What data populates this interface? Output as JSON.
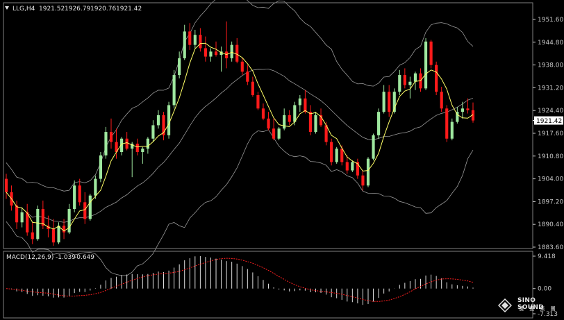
{
  "header": {
    "symbol": "LLG,H4",
    "open": "1921.52",
    "high": "1926.79",
    "low": "1920.76",
    "close": "1921.42"
  },
  "macd_header": {
    "label": "MACD(12,26,9)",
    "macd_value": "-1.039",
    "signal_value": "-0.649"
  },
  "price_axis": {
    "ticks": [
      "1951.60",
      "1944.80",
      "1938.00",
      "1931.20",
      "1924.40",
      "1917.60",
      "1910.80",
      "1904.00",
      "1897.20",
      "1890.40",
      "1883.60"
    ],
    "current_price": "1921.42"
  },
  "macd_axis": {
    "ticks": [
      "9.418",
      "0.00",
      "-7.313"
    ]
  },
  "colors": {
    "bull": "#9fe89f",
    "bear": "#ff1a1a",
    "ma": "#ffff66",
    "bands": "#9a9a9a",
    "histogram": "#e0e0e0",
    "signal": "#ff2020"
  },
  "watermark": {
    "name": "SINO SOUND",
    "sub": "漢 聲 集 團"
  },
  "chart_data": {
    "type": "candlestick",
    "symbol": "LLG",
    "timeframe": "H4",
    "ylim": [
      1883.6,
      1954.0
    ],
    "indicators": [
      "Bollinger Bands",
      "Moving Average",
      "MACD(12,26,9)"
    ],
    "ohlc": [
      [
        1904.0,
        1905.5,
        1898.0,
        1900.0
      ],
      [
        1900.0,
        1902.0,
        1894.5,
        1896.0
      ],
      [
        1896.0,
        1897.5,
        1889.0,
        1891.0
      ],
      [
        1891.0,
        1895.5,
        1889.5,
        1894.0
      ],
      [
        1894.0,
        1896.5,
        1887.0,
        1888.0
      ],
      [
        1888.0,
        1891.0,
        1884.5,
        1886.0
      ],
      [
        1886.0,
        1896.0,
        1885.5,
        1895.0
      ],
      [
        1895.0,
        1897.5,
        1889.0,
        1890.0
      ],
      [
        1890.0,
        1893.0,
        1886.5,
        1889.0
      ],
      [
        1889.0,
        1892.0,
        1884.0,
        1885.0
      ],
      [
        1885.0,
        1891.0,
        1884.5,
        1890.0
      ],
      [
        1890.0,
        1892.0,
        1886.0,
        1888.0
      ],
      [
        1888.0,
        1896.5,
        1887.5,
        1895.0
      ],
      [
        1895.0,
        1903.5,
        1894.0,
        1902.0
      ],
      [
        1902.0,
        1904.0,
        1896.0,
        1897.0
      ],
      [
        1897.0,
        1900.0,
        1890.5,
        1892.0
      ],
      [
        1892.0,
        1899.5,
        1891.5,
        1899.0
      ],
      [
        1899.0,
        1905.0,
        1898.0,
        1904.0
      ],
      [
        1904.0,
        1912.0,
        1903.0,
        1911.0
      ],
      [
        1911.0,
        1919.5,
        1910.0,
        1918.0
      ],
      [
        1918.0,
        1922.0,
        1913.0,
        1915.0
      ],
      [
        1915.0,
        1919.0,
        1910.0,
        1912.0
      ],
      [
        1912.0,
        1916.5,
        1911.0,
        1916.0
      ],
      [
        1916.0,
        1918.0,
        1912.5,
        1913.0
      ],
      [
        1913.0,
        1915.0,
        1904.5,
        1914.5
      ],
      [
        1914.5,
        1916.0,
        1911.0,
        1912.0
      ],
      [
        1912.0,
        1913.5,
        1908.5,
        1913.0
      ],
      [
        1913.0,
        1916.5,
        1911.5,
        1916.0
      ],
      [
        1916.0,
        1921.5,
        1915.0,
        1920.0
      ],
      [
        1920.0,
        1924.5,
        1919.0,
        1923.0
      ],
      [
        1923.0,
        1924.0,
        1915.5,
        1917.0
      ],
      [
        1917.0,
        1927.0,
        1916.0,
        1926.0
      ],
      [
        1926.0,
        1936.5,
        1925.0,
        1935.0
      ],
      [
        1935.0,
        1942.0,
        1934.0,
        1940.0
      ],
      [
        1940.0,
        1950.0,
        1939.5,
        1948.0
      ],
      [
        1948.0,
        1950.5,
        1942.5,
        1944.0
      ],
      [
        1944.0,
        1948.5,
        1943.0,
        1947.0
      ],
      [
        1947.0,
        1949.0,
        1942.0,
        1943.0
      ],
      [
        1943.0,
        1946.5,
        1939.0,
        1940.5
      ],
      [
        1940.5,
        1943.0,
        1939.0,
        1942.0
      ],
      [
        1942.0,
        1945.0,
        1940.5,
        1941.0
      ],
      [
        1941.0,
        1943.5,
        1936.0,
        1942.0
      ],
      [
        1942.0,
        1951.0,
        1937.0,
        1940.0
      ],
      [
        1940.0,
        1945.0,
        1939.0,
        1944.0
      ],
      [
        1944.0,
        1946.0,
        1938.5,
        1939.0
      ],
      [
        1939.0,
        1940.0,
        1935.0,
        1936.0
      ],
      [
        1936.0,
        1938.0,
        1932.0,
        1933.0
      ],
      [
        1933.0,
        1934.5,
        1928.5,
        1929.0
      ],
      [
        1929.0,
        1930.0,
        1924.5,
        1925.0
      ],
      [
        1925.0,
        1926.5,
        1921.5,
        1922.0
      ],
      [
        1922.0,
        1924.0,
        1918.5,
        1919.0
      ],
      [
        1919.0,
        1922.0,
        1915.5,
        1916.0
      ],
      [
        1916.0,
        1919.5,
        1915.5,
        1919.0
      ],
      [
        1919.0,
        1925.0,
        1918.5,
        1923.0
      ],
      [
        1923.0,
        1924.5,
        1920.0,
        1921.0
      ],
      [
        1921.0,
        1927.0,
        1920.0,
        1926.0
      ],
      [
        1926.0,
        1929.0,
        1924.0,
        1928.0
      ],
      [
        1928.0,
        1930.5,
        1923.5,
        1924.0
      ],
      [
        1924.0,
        1926.0,
        1917.0,
        1918.0
      ],
      [
        1918.0,
        1924.0,
        1917.5,
        1923.0
      ],
      [
        1923.0,
        1925.0,
        1919.5,
        1920.0
      ],
      [
        1920.0,
        1921.0,
        1914.0,
        1915.0
      ],
      [
        1915.0,
        1916.0,
        1908.0,
        1909.0
      ],
      [
        1909.0,
        1913.5,
        1908.5,
        1913.0
      ],
      [
        1913.0,
        1914.0,
        1908.0,
        1909.0
      ],
      [
        1909.0,
        1911.0,
        1905.5,
        1906.5
      ],
      [
        1906.5,
        1909.5,
        1906.0,
        1909.0
      ],
      [
        1909.0,
        1910.0,
        1904.0,
        1905.0
      ],
      [
        1905.0,
        1906.5,
        1900.5,
        1902.0
      ],
      [
        1902.0,
        1910.5,
        1901.5,
        1910.0
      ],
      [
        1910.0,
        1917.5,
        1909.5,
        1917.0
      ],
      [
        1917.0,
        1925.0,
        1916.0,
        1924.0
      ],
      [
        1924.0,
        1932.0,
        1923.5,
        1930.0
      ],
      [
        1930.0,
        1932.0,
        1922.5,
        1924.0
      ],
      [
        1924.0,
        1931.0,
        1923.5,
        1930.0
      ],
      [
        1930.0,
        1936.5,
        1929.0,
        1935.0
      ],
      [
        1935.0,
        1937.0,
        1931.0,
        1932.0
      ],
      [
        1932.0,
        1934.5,
        1928.0,
        1933.0
      ],
      [
        1933.0,
        1936.0,
        1930.5,
        1935.5
      ],
      [
        1935.5,
        1937.0,
        1930.0,
        1931.0
      ],
      [
        1931.0,
        1946.0,
        1930.5,
        1945.0
      ],
      [
        1945.0,
        1945.5,
        1937.0,
        1938.0
      ],
      [
        1938.0,
        1939.0,
        1929.0,
        1930.0
      ],
      [
        1930.0,
        1931.5,
        1924.0,
        1925.0
      ],
      [
        1925.0,
        1926.0,
        1915.0,
        1916.0
      ],
      [
        1916.0,
        1922.0,
        1915.5,
        1921.0
      ],
      [
        1921.0,
        1925.5,
        1920.5,
        1924.0
      ],
      [
        1924.0,
        1927.0,
        1922.0,
        1925.0
      ],
      [
        1925.0,
        1928.0,
        1923.5,
        1924.5
      ],
      [
        1924.5,
        1926.79,
        1920.76,
        1921.42
      ]
    ],
    "macd": {
      "histogram_range": [
        -7.313,
        9.418
      ],
      "last_macd": -1.039,
      "last_signal": -0.649,
      "line_color": "white histogram",
      "signal_color": "red dashed"
    }
  }
}
